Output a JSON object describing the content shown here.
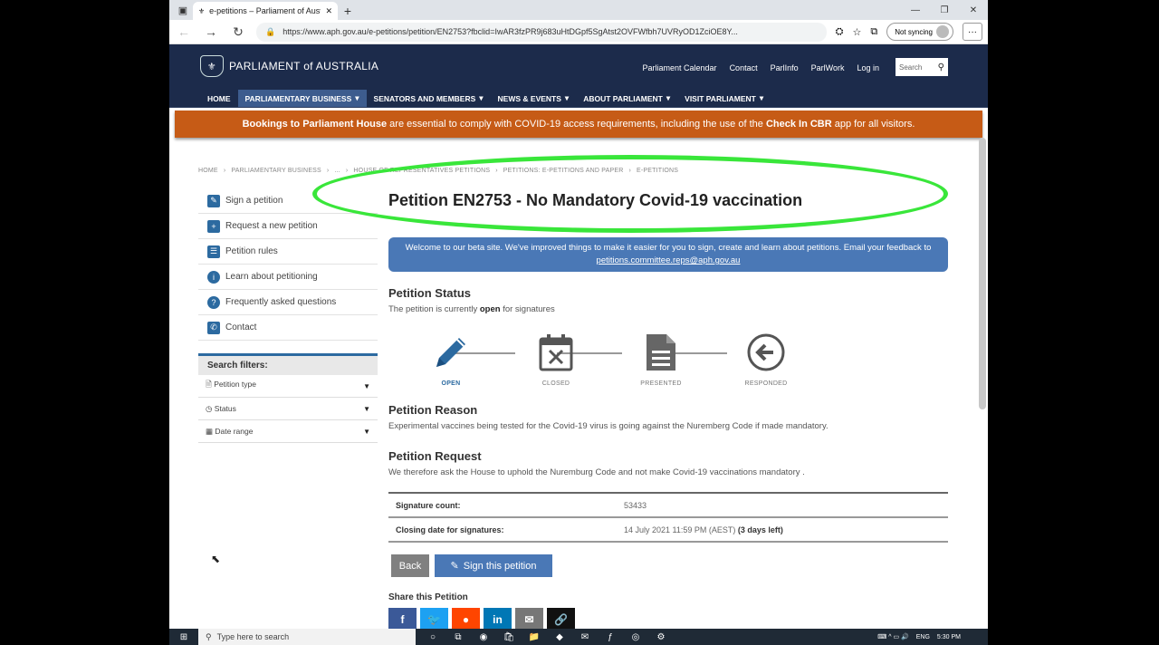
{
  "browser": {
    "tab_title": "e-petitions – Parliament of Austl",
    "url": "https://www.aph.gov.au/e-petitions/petition/EN2753?fbclid=IwAR3fzPR9j683uHtDGpf5SgAtst2OVFWfbh7UVRyOD1ZciOE8Y...",
    "sync_label": "Not syncing"
  },
  "site": {
    "logo_text": "PARLIAMENT of AUSTRALIA",
    "top_links": [
      "Parliament Calendar",
      "Contact",
      "ParlInfo",
      "ParlWork",
      "Log in"
    ],
    "search_placeholder": "Search",
    "nav": [
      {
        "label": "HOME",
        "caret": ""
      },
      {
        "label": "PARLIAMENTARY BUSINESS",
        "caret": "▾"
      },
      {
        "label": "SENATORS AND MEMBERS",
        "caret": "▾"
      },
      {
        "label": "NEWS & EVENTS",
        "caret": "▾"
      },
      {
        "label": "ABOUT PARLIAMENT",
        "caret": "▾"
      },
      {
        "label": "VISIT PARLIAMENT",
        "caret": "▾"
      }
    ],
    "banner": {
      "bold1": "Bookings to Parliament House",
      "text1": " are essential to comply with COVID-19 access requirements, including the use of the ",
      "bold2": "Check In CBR",
      "text2": " app for all visitors."
    }
  },
  "breadcrumb": [
    "HOME",
    "›",
    "PARLIAMENTARY BUSINESS",
    "›",
    "...",
    "›",
    "HOUSE OF REPRESENTATIVES PETITIONS",
    "›",
    "PETITIONS: E-PETITIONS AND PAPER",
    "›",
    "E-PETITIONS"
  ],
  "sidebar": {
    "items": [
      {
        "label": "Sign a petition",
        "icon": "✎"
      },
      {
        "label": "Request a new petition",
        "icon": "+"
      },
      {
        "label": "Petition rules",
        "icon": "☰"
      },
      {
        "label": "Learn about petitioning",
        "icon": "i"
      },
      {
        "label": "Frequently asked questions",
        "icon": "?"
      },
      {
        "label": "Contact",
        "icon": "✆"
      }
    ],
    "filters_title": "Search filters:",
    "filters": [
      {
        "label": "Petition type",
        "icon": "🗎"
      },
      {
        "label": "Status",
        "icon": "◷"
      },
      {
        "label": "Date range",
        "icon": "▦"
      }
    ]
  },
  "petition": {
    "title": "Petition EN2753 - No Mandatory Covid-19 vaccination",
    "beta_text": "Welcome to our beta site. We've improved things to make it easier for you to sign, create and learn about petitions. Email your feedback to ",
    "beta_email": "petitions.committee.reps@aph.gov.au",
    "status_heading": "Petition Status",
    "status_pre": "The petition is currently ",
    "status_bold": "open",
    "status_post": " for signatures",
    "steps": [
      "OPEN",
      "CLOSED",
      "PRESENTED",
      "RESPONDED"
    ],
    "reason_heading": "Petition Reason",
    "reason_text": "Experimental vaccines being tested for the Covid-19 virus is going against the Nuremberg Code if made mandatory.",
    "request_heading": "Petition Request",
    "request_text": "We therefore ask the House to uphold the Nuremburg Code and not make Covid-19 vaccinations mandatory .",
    "sig_label": "Signature count:",
    "sig_value": "53433",
    "close_label": "Closing date for signatures:",
    "close_value": "14 July 2021 11:59 PM (AEST) ",
    "close_bold": "(3 days left)",
    "back_label": "Back",
    "sign_label": "Sign this petition",
    "share_heading": "Share this Petition"
  },
  "taskbar": {
    "search_placeholder": "Type here to search",
    "lang": "ENG",
    "time": "5:30 PM"
  },
  "colors": {
    "navy": "#1c2b4b",
    "orange": "#c65b16",
    "blue": "#4a78b6",
    "highlight": "#39e63a"
  }
}
